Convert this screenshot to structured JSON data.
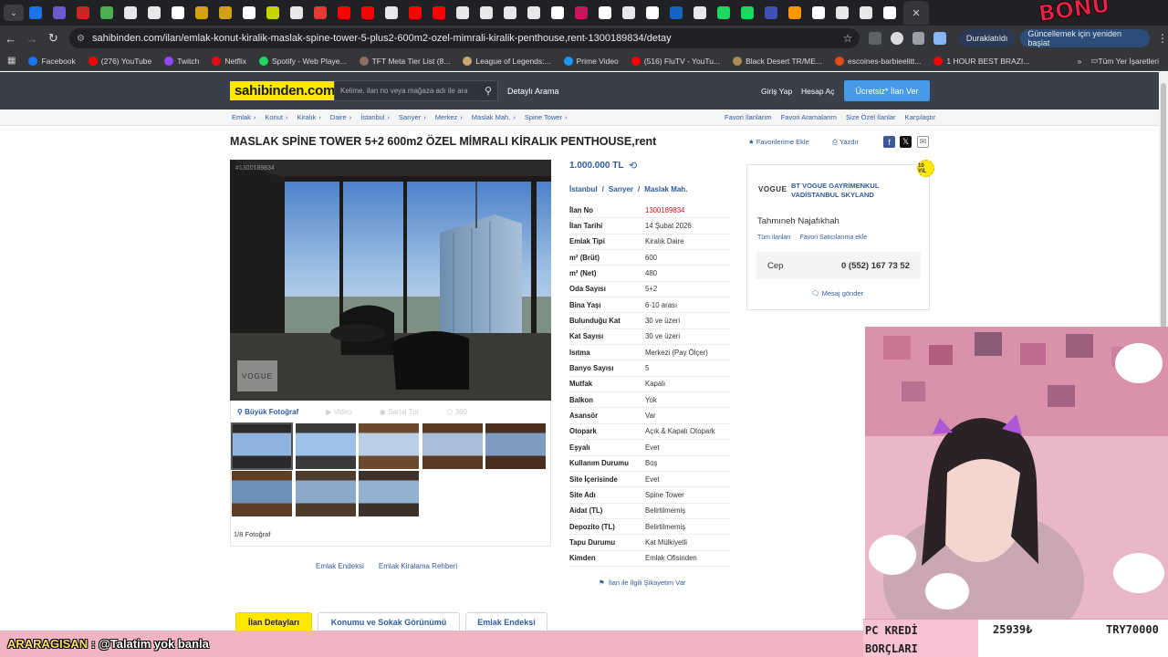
{
  "browser": {
    "url": "sahibinden.com/ilan/emlak-konut-kiralik-maslak-spine-tower-5-plus2-600m2-ozel-mimrali-kiralik-penthouse,rent-1300189834/detay",
    "paused_label": "Duraklatıldı",
    "update_label": "Güncellemek için yeniden başlat",
    "tab_colors": [
      "#1a73e8",
      "#6a5acd",
      "#c62828",
      "#4caf50",
      "#e8e8e8",
      "#e8e8e8",
      "#ffffff",
      "#d4a017",
      "#d4a017",
      "#ffffff",
      "#c6d400",
      "#e8e8e8",
      "#e53935",
      "#ff0000",
      "#ff0000",
      "#e8e8e8",
      "#ff0000",
      "#ff0000",
      "#e8e8e8",
      "#e8e8e8",
      "#e8e8e8",
      "#e8e8e8",
      "#ffffff",
      "#c2185b",
      "#ffffff",
      "#e8e8e8",
      "#ffffff",
      "#1565c0",
      "#e8e8e8",
      "#1ed760",
      "#1ed760",
      "#3f51b5",
      "#ff9800",
      "#ffffff",
      "#e8e8e8",
      "#e8e8e8",
      "#ffffff"
    ]
  },
  "bookmarks": [
    {
      "label": "Facebook",
      "color": "#1877f2"
    },
    {
      "label": "(276) YouTube",
      "color": "#ff0000"
    },
    {
      "label": "Twitch",
      "color": "#9146ff"
    },
    {
      "label": "Netflix",
      "color": "#e50914"
    },
    {
      "label": "Spotify - Web Playe...",
      "color": "#1ed760"
    },
    {
      "label": "TFT Meta Tier List (8...",
      "color": "#8d6e63"
    },
    {
      "label": "League of Legends:...",
      "color": "#c8aa6e"
    },
    {
      "label": "Prime Video",
      "color": "#1a98ff"
    },
    {
      "label": "(516) FluTV - YouTu...",
      "color": "#ff0000"
    },
    {
      "label": "Black Desert TR/ME...",
      "color": "#b08d57"
    },
    {
      "label": "escoines-barbieelitt...",
      "color": "#e64a19"
    },
    {
      "label": "1 HOUR BEST BRAZI...",
      "color": "#ff0000"
    }
  ],
  "bookmarks_all": "Tüm Yer İşaretleri",
  "site": {
    "logo": "sahibinden.com",
    "search_placeholder": "Kelime, ilan no veya mağaza adı ile ara",
    "advanced_search": "Detaylı Arama",
    "login": "Giriş Yap",
    "register": "Hesap Aç",
    "post_ad": "Ücretsiz* İlan Ver"
  },
  "breadcrumbs": [
    "Emlak",
    "Konut",
    "Kiralık",
    "Daire",
    "İstanbul",
    "Sarıyer",
    "Merkez",
    "Maslak Mah.",
    "Spine Tower"
  ],
  "crumb_links": [
    "Favori İlanlarım",
    "Favori Aramalarım",
    "Size Özel İlanlar",
    "Karşılaştır"
  ],
  "listing": {
    "title": "MASLAK SPİNE TOWER 5+2 600m2 ÖZEL MİMRALI KİRALIK PENTHOUSE,rent",
    "add_fav": "Favorilerime Ekle",
    "print": "Yazdır",
    "price": "1.000.000 TL",
    "location": [
      "İstanbul",
      "/",
      "Sarıyer",
      "/",
      "Maslak Mah."
    ],
    "photo_id": "#1300189834",
    "watermark": "VOGUE",
    "photo_tools": [
      "Büyük Fotoğraf",
      "Video",
      "Sanal Tur",
      "360"
    ],
    "photo_count": "1/8 Fotoğraf",
    "footer_links": [
      "Emlak Endeksi",
      "Emlak Kiralama Rehberi"
    ],
    "complaint": "İlan ile İlgili Şikayetim Var",
    "bottom_tabs": [
      "İlan Detayları",
      "Konumu ve Sokak Görünümü",
      "Emlak Endeksi"
    ],
    "details": [
      {
        "k": "İlan No",
        "v": "1300189834"
      },
      {
        "k": "İlan Tarihi",
        "v": "14 Şubat 2026"
      },
      {
        "k": "Emlak Tipi",
        "v": "Kiralık Daire"
      },
      {
        "k": "m² (Brüt)",
        "v": "600"
      },
      {
        "k": "m² (Net)",
        "v": "480"
      },
      {
        "k": "Oda Sayısı",
        "v": "5+2"
      },
      {
        "k": "Bina Yaşı",
        "v": "6-10 arası"
      },
      {
        "k": "Bulunduğu Kat",
        "v": "30 ve üzeri"
      },
      {
        "k": "Kat Sayısı",
        "v": "30 ve üzeri"
      },
      {
        "k": "Isıtma",
        "v": "Merkezi (Pay Ölçer)"
      },
      {
        "k": "Banyo Sayısı",
        "v": "5"
      },
      {
        "k": "Mutfak",
        "v": "Kapalı"
      },
      {
        "k": "Balkon",
        "v": "Yok"
      },
      {
        "k": "Asansör",
        "v": "Var"
      },
      {
        "k": "Otopark",
        "v": "Açık & Kapalı Otopark"
      },
      {
        "k": "Eşyalı",
        "v": "Evet"
      },
      {
        "k": "Kullanım Durumu",
        "v": "Boş"
      },
      {
        "k": "Site İçerisinde",
        "v": "Evet"
      },
      {
        "k": "Site Adı",
        "v": "Spine Tower"
      },
      {
        "k": "Aidat (TL)",
        "v": "Belirtilmemiş"
      },
      {
        "k": "Depozito (TL)",
        "v": "Belirtilmemiş"
      },
      {
        "k": "Tapu Durumu",
        "v": "Kat Mülkiyetli"
      },
      {
        "k": "Kimden",
        "v": "Emlak Ofisinden"
      }
    ]
  },
  "seller": {
    "badge": "10 YIL",
    "logo": "VOGUE",
    "firm": "BT VOGUE GAYRİMENKUL VADİSTANBUL SKYLAND",
    "name": "Tahmıneh Najafıkhah",
    "all_ads": "Tüm ilanları",
    "add_fav_seller": "Favori Satıcılarıma ekle",
    "phone_label": "Cep",
    "phone": "0 (552) 167 73 52",
    "message": "Mesaj gönder"
  },
  "stream": {
    "chat_user": "ARARAGISAN",
    "chat_message": ": @Talatim yok banla",
    "credit_label_1": "PC KREDİ",
    "credit_label_2": "BORÇLARI",
    "credit_value": "25939₺",
    "credit_try": "TRY70000"
  }
}
